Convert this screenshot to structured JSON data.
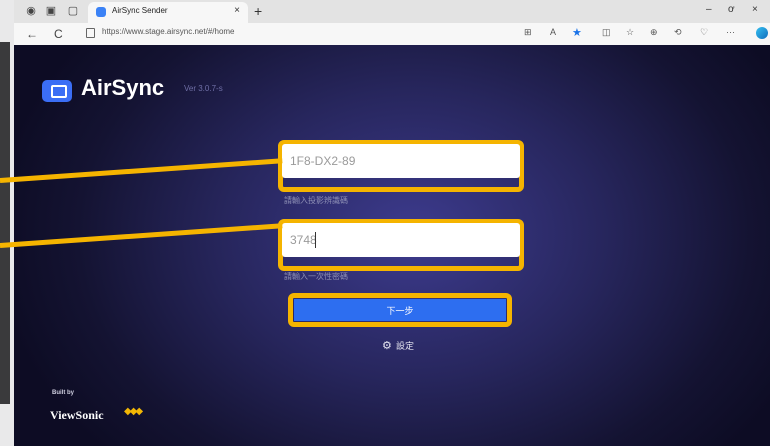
{
  "browser": {
    "tab_title": "AirSync Sender",
    "tab_close": "×",
    "new_tab": "+",
    "url": "https://www.stage.airsync.net/#/home",
    "nav": {
      "back": "←",
      "refresh": "C"
    },
    "toolbar": {
      "reader": "⊞",
      "read_aloud": "A",
      "favorite": "★",
      "split": "◫",
      "collections": "☆",
      "extensions": "⊕",
      "history": "⟲",
      "performance": "♡",
      "more": "···"
    },
    "window_controls": {
      "minimize": "–",
      "restore": "ơ",
      "close": "×"
    }
  },
  "app": {
    "name": "AirSync",
    "version": "Ver 3.0.7-s",
    "code_input": {
      "value": "1F8-DX2-89",
      "hint": "請輸入投影辨識碼"
    },
    "password_input": {
      "value": "3748",
      "hint": "請輸入一次性密碼"
    },
    "next_button": "下一步",
    "settings_label": "設定",
    "footer": {
      "built_by": "Built by",
      "brand": "ViewSonic"
    }
  },
  "colors": {
    "highlight": "#f5b400",
    "primary": "#2d6ef0",
    "background": "#27265d"
  }
}
